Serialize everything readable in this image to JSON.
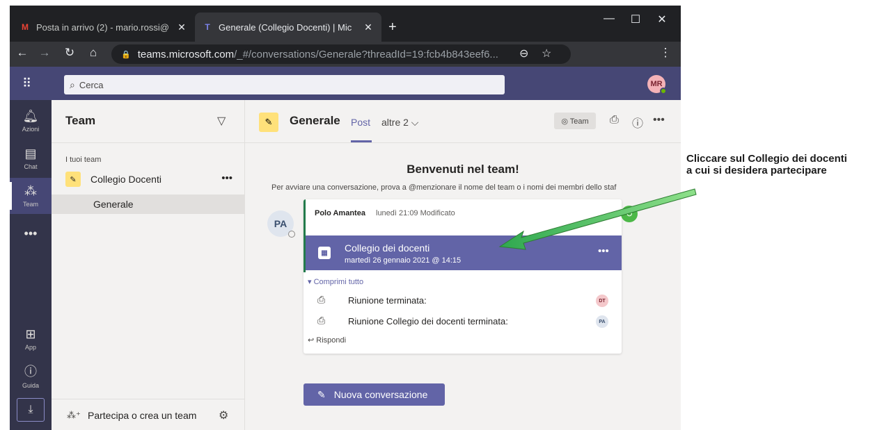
{
  "browser": {
    "tabs": [
      {
        "favicon": "gmail-icon",
        "title": "Posta in arrivo (2) - mario.rossi@",
        "close": "✕"
      },
      {
        "favicon": "teams-icon",
        "title": "Generale (Collegio Docenti) | Mic",
        "close": "✕"
      }
    ],
    "new_tab": "+",
    "url_host": "teams.microsoft.com",
    "url_path": "/_#/conversations/Generale?threadId=19:fcb4b843eef6..."
  },
  "teams": {
    "search_placeholder": "Cerca",
    "me_initials": "MR",
    "rail": [
      {
        "icon": "bell-icon",
        "label": "Azioni"
      },
      {
        "icon": "chat-icon",
        "label": "Chat"
      },
      {
        "icon": "teams-icon",
        "label": "Team"
      },
      {
        "icon": "more-icon",
        "label": ""
      },
      {
        "icon": "apps-icon",
        "label": "App"
      },
      {
        "icon": "help-icon",
        "label": "Guida"
      }
    ],
    "panel": {
      "title": "Team",
      "section": "I tuoi team",
      "team_name": "Collegio Docenti",
      "channel": "Generale",
      "join_label": "Partecipa o crea un team"
    },
    "channel": {
      "name": "Generale",
      "tab_post": "Post",
      "tab_more": "altre 2 ⌵",
      "team_pill": "◎ Team"
    },
    "welcome": {
      "title": "Benvenuti nel team!",
      "subtitle": "Per avviare una conversazione, prova a @menzionare il nome del team o i nomi dei membri dello staf"
    },
    "post": {
      "avatar": "PA",
      "author": "Polo Amantea",
      "time": "lunedì 21:09  Modificato",
      "meeting_title": "Collegio dei docenti",
      "meeting_date": "martedì 26 gennaio 2021 @ 14:15",
      "collapse": "Comprimi tutto",
      "replies": [
        {
          "text": "Riunione terminata:",
          "avatar": "DT",
          "avatar_color": "#f4c8cb"
        },
        {
          "text": "Riunione Collegio dei docenti terminata:",
          "avatar": "PA",
          "avatar_color": "#dfe5ee"
        }
      ],
      "reply_link": "Rispondi"
    },
    "new_conversation": "Nuova conversazione"
  },
  "annotation": {
    "line1": "Cliccare sul Collegio dei docenti",
    "line2": "a cui si desidera partecipare"
  },
  "colors": {
    "teams_purple": "#6264a7",
    "topbar": "#464775",
    "rail": "#33344a",
    "arrow": "#4cb848"
  }
}
